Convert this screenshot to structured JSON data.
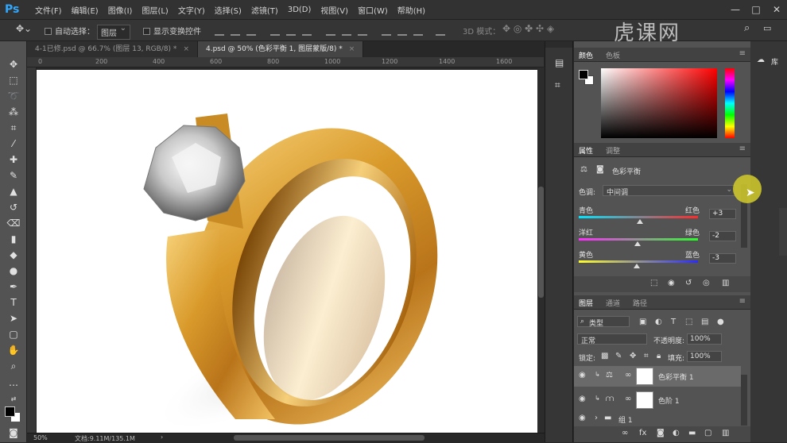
{
  "app": {
    "logo": "Ps"
  },
  "menu": [
    "文件(F)",
    "编辑(E)",
    "图像(I)",
    "图层(L)",
    "文字(Y)",
    "选择(S)",
    "滤镜(T)",
    "3D(D)",
    "视图(V)",
    "窗口(W)",
    "帮助(H)"
  ],
  "window_controls": {
    "minimize": "—",
    "maximize": "□",
    "close": "✕"
  },
  "options": {
    "auto_select_label": "自动选择：",
    "auto_select_value": "图层",
    "show_transform_label": "显示变换控件",
    "mode_3d_label": "3D 模式："
  },
  "watermark": "虎课网",
  "tabs": [
    {
      "label": "4-1已修.psd @ 66.7% (图层 13, RGB/8) *",
      "close": "×"
    },
    {
      "label": "4.psd @ 50% (色彩平衡 1, 图层蒙版/8) *",
      "close": "×"
    }
  ],
  "ruler_ticks": [
    "0",
    "200",
    "400",
    "600",
    "800",
    "1000",
    "1200",
    "1400",
    "1600"
  ],
  "status": {
    "zoom": "50%",
    "doc": "文档:9.11M/135.1M"
  },
  "color_panel": {
    "tabs": [
      "颜色",
      "色板"
    ]
  },
  "properties_panel": {
    "tabs": [
      "属性",
      "调整"
    ],
    "title": "色彩平衡",
    "tone_label": "色调:",
    "tone_value": "中间调",
    "sliders": [
      {
        "left": "青色",
        "right": "红色",
        "value": "+3",
        "level": 0.515
      },
      {
        "left": "洋红",
        "right": "绿色",
        "value": "-2",
        "level": 0.49
      },
      {
        "left": "黄色",
        "right": "蓝色",
        "value": "-3",
        "level": 0.485
      }
    ]
  },
  "layers_panel": {
    "tabs": [
      "图层",
      "通道",
      "路径"
    ],
    "filter_value": "类型",
    "blend_mode": "正常",
    "opacity_label": "不透明度:",
    "opacity_value": "100%",
    "lock_label": "锁定:",
    "fill_label": "填充:",
    "fill_value": "100%",
    "layers": [
      {
        "name": "色彩平衡 1",
        "selected": true
      },
      {
        "name": "色阶 1",
        "selected": false
      },
      {
        "name": "组 1",
        "selected": false
      }
    ]
  },
  "far_right": {
    "library_label": "库"
  },
  "colors": {
    "accent": "#31a8ff",
    "canvas": "#ffffff",
    "panel": "#535353",
    "cursor": "#d4cc2c"
  }
}
